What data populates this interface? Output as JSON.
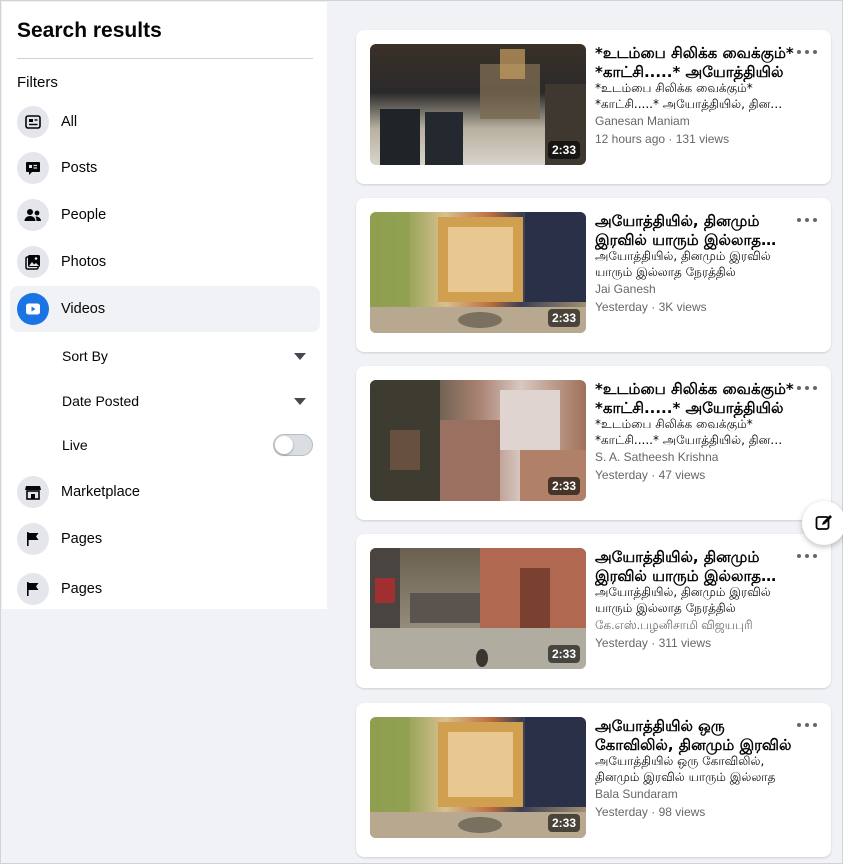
{
  "sidebar": {
    "title": "Search results",
    "filters_label": "Filters",
    "nav": [
      {
        "label": "All",
        "icon": "all-icon"
      },
      {
        "label": "Posts",
        "icon": "posts-icon"
      },
      {
        "label": "People",
        "icon": "people-icon"
      },
      {
        "label": "Photos",
        "icon": "photos-icon"
      },
      {
        "label": "Videos",
        "icon": "video-icon",
        "active": true
      },
      {
        "label": "Marketplace",
        "icon": "marketplace-icon"
      },
      {
        "label": "Pages",
        "icon": "flag-icon"
      },
      {
        "label": "Pages",
        "icon": "flag-icon"
      }
    ],
    "sub_filters": {
      "sort_by": "Sort By",
      "date_posted": "Date Posted",
      "live": "Live",
      "live_on": false
    }
  },
  "results": [
    {
      "title": "*உடம்பை சிலிக்க வைக்கும்* *காட்சி.....* அயோத்தியில்",
      "description": "*உடம்பை சிலிக்க வைக்கும்* *காட்சி.....* அயோத்தியில், தினமும் இரவில்",
      "author": "Ganesan Maniam",
      "meta": "12 hours ago · 131 views",
      "duration": "2:33"
    },
    {
      "title": "அயோத்தியில், தினமும் இரவில் யாரும் இல்லாத நேரத்தில்",
      "description": "அயோத்தியில், தினமும் இரவில் யாரும் இல்லாத நேரத்தில்",
      "author": "Jai Ganesh",
      "meta": "Yesterday · 3K views",
      "duration": "2:33"
    },
    {
      "title": "*உடம்பை சிலிக்க வைக்கும்* *காட்சி.....* அயோத்தியில்",
      "description": "*உடம்பை சிலிக்க வைக்கும்* *காட்சி.....* அயோத்தியில், தினமும் இரவில்",
      "author": "S. A. Satheesh Krishna",
      "meta": "Yesterday · 47 views",
      "duration": "2:33"
    },
    {
      "title": "அயோத்தியில், தினமும் இரவில் யாரும் இல்லாத நேரத்தில்",
      "description": "அயோத்தியில், தினமும் இரவில் யாரும் இல்லாத நேரத்தில்",
      "author": "கே.எஸ்.பழனிசாமி விஜயபுரி",
      "meta": "Yesterday · 311 views",
      "duration": "2:33"
    },
    {
      "title": "அயோத்தியில் ஒரு கோவிலில், தினமும் இரவில்",
      "description": "அயோத்தியில் ஒரு கோவிலில், தினமும் இரவில் யாரும் இல்லாத",
      "author": "Bala Sundaram",
      "meta": "Yesterday · 98 views",
      "duration": "2:33"
    }
  ],
  "colors": {
    "accent": "#1b74e4",
    "background": "#f0f2f5",
    "secondary_text": "#65676b"
  }
}
